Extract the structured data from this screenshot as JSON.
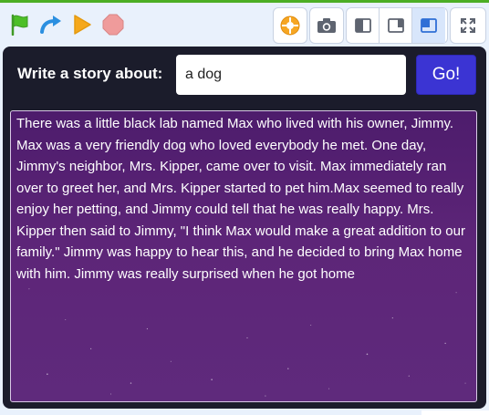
{
  "toolbar": {
    "green_flag": "green-flag-icon",
    "turbo": "turbo-arrow-icon",
    "run": "play-icon",
    "stop": "stop-icon",
    "addon": "addon-icon",
    "camera": "camera-icon",
    "layout_small": "small-stage-icon",
    "layout_normal": "normal-stage-icon",
    "layout_large": "large-stage-icon",
    "fullscreen": "fullscreen-icon",
    "active_layout": "large"
  },
  "colors": {
    "accent_green": "#4cae24",
    "go_button": "#3b34d3",
    "story_background": "#5d2578",
    "stage_background": "#1b1c2b"
  },
  "prompt": {
    "label": "Write a story about:",
    "value": "a dog",
    "button_label": "Go!"
  },
  "story": {
    "text": "There was a little black lab named Max who lived with his owner, Jimmy. Max was a very friendly dog who loved everybody he met. One day, Jimmy's neighbor, Mrs. Kipper, came over to visit. Max immediately ran over to greet her, and Mrs. Kipper started to pet him.Max seemed to really enjoy her petting, and Jimmy could tell that he was really happy. Mrs. Kipper then said to Jimmy, \"I think Max would make a great addition to our family.\" Jimmy was happy to hear this, and he decided to bring Max home with him. Jimmy was really surprised when he got home"
  }
}
